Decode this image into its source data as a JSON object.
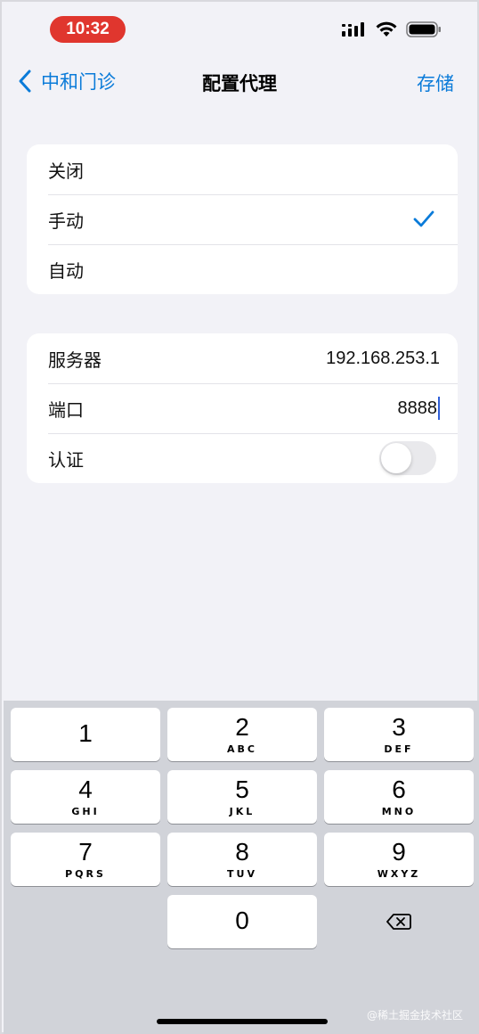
{
  "status_bar": {
    "time": "10:32"
  },
  "nav": {
    "back_label": "中和门诊",
    "title": "配置代理",
    "save_label": "存储"
  },
  "proxy_modes": [
    {
      "label": "关闭",
      "selected": false
    },
    {
      "label": "手动",
      "selected": true
    },
    {
      "label": "自动",
      "selected": false
    }
  ],
  "settings": {
    "server_label": "服务器",
    "server_value": "192.168.253.1",
    "port_label": "端口",
    "port_value": "8888",
    "auth_label": "认证",
    "auth_enabled": false
  },
  "keyboard": {
    "keys": [
      {
        "digit": "1",
        "letters": ""
      },
      {
        "digit": "2",
        "letters": "ABC"
      },
      {
        "digit": "3",
        "letters": "DEF"
      },
      {
        "digit": "4",
        "letters": "GHI"
      },
      {
        "digit": "5",
        "letters": "JKL"
      },
      {
        "digit": "6",
        "letters": "MNO"
      },
      {
        "digit": "7",
        "letters": "PQRS"
      },
      {
        "digit": "8",
        "letters": "TUV"
      },
      {
        "digit": "9",
        "letters": "WXYZ"
      },
      {
        "digit": "0",
        "letters": ""
      }
    ]
  },
  "watermark": "@稀土掘金技术社区",
  "colors": {
    "accent": "#0a7bd9",
    "time_pill": "#e0362e"
  }
}
